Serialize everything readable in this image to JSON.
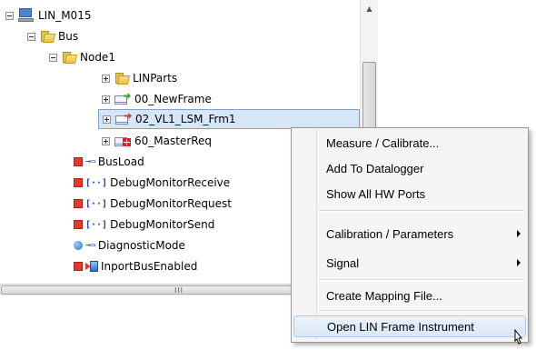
{
  "tree": {
    "root_label": "LIN_M015",
    "bus_label": "Bus",
    "node_label": "Node1",
    "children": [
      "LINParts",
      "00_NewFrame",
      "02_VL1_LSM_Frm1",
      "60_MasterReq"
    ],
    "signals": [
      {
        "label": "BusLoad",
        "type_icon": "port-arrow-icon",
        "mini": "+"
      },
      {
        "label": "DebugMonitorReceive",
        "type_icon": "bracket-icon",
        "mini": "[··]"
      },
      {
        "label": "DebugMonitorRequest",
        "type_icon": "bracket-icon",
        "mini": "[··]"
      },
      {
        "label": "DebugMonitorSend",
        "type_icon": "bracket-icon",
        "mini": "[··]"
      },
      {
        "label": "DiagnosticMode",
        "type_icon": "port-arrow-icon",
        "mini": "+"
      },
      {
        "label": "InportBusEnabled",
        "type_icon": "inport-icon",
        "mini": ""
      }
    ],
    "selected": "02_VL1_LSM_Frm1"
  },
  "hscroll": {
    "grip": "III"
  },
  "context_menu": {
    "items": [
      {
        "label": "Measure / Calibrate...",
        "submenu": false
      },
      {
        "label": "Add To Datalogger",
        "submenu": false
      },
      {
        "label": "Show All HW Ports",
        "submenu": false
      },
      {
        "label": "Calibration / Parameters",
        "submenu": true
      },
      {
        "label": "Signal",
        "submenu": true
      },
      {
        "label": "Create Mapping File...",
        "submenu": false
      },
      {
        "label": "Open LIN Frame Instrument",
        "submenu": false
      }
    ],
    "hovered": "Open LIN Frame Instrument"
  },
  "colors": {
    "selection": "#d7e6f7",
    "menu_bg": "#f5f5f5",
    "hover": "#d9e8f8"
  }
}
